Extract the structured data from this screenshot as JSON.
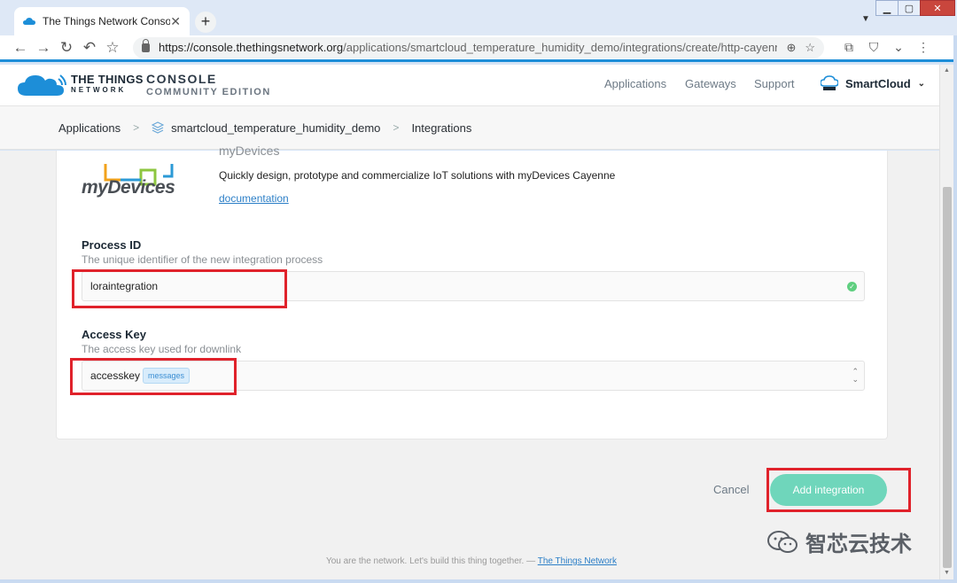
{
  "browser": {
    "tab_title": "The Things Network Console",
    "tab_close": "✕",
    "new_tab": "+",
    "tab_dropdown": "▼",
    "window_minimize": "▁",
    "window_maximize": "▢",
    "window_close": "✕",
    "url_host": "https://console.thethingsnetwork.org",
    "url_path": "/applications/smartcloud_temperature_humidity_demo/integrations/create/http-cayenne",
    "back": "←",
    "forward": "→",
    "reload": "↻",
    "undo": "↶",
    "bookmark": "☆",
    "zoom_icon": "⊕",
    "star_icon": "☆",
    "crop_icon": "⧉",
    "shield_icon": "⛉",
    "menu_icon": "⋮"
  },
  "header": {
    "brand_line1": "THE THINGS",
    "brand_line2": "NETWORK",
    "console_line1": "CONSOLE",
    "console_line2": "COMMUNITY EDITION",
    "nav": [
      "Applications",
      "Gateways",
      "Support"
    ],
    "user": "SmartCloud",
    "user_chevron": "⌄",
    "brand_color": "#1d8ed8"
  },
  "breadcrumb": {
    "items": [
      "Applications",
      "smartcloud_temperature_humidity_demo",
      "Integrations"
    ],
    "separator": ">"
  },
  "integration": {
    "name": "myDevices",
    "logo_text": "myDevices",
    "description": "Quickly design, prototype and commercialize IoT solutions with myDevices Cayenne",
    "documentation_link": "documentation"
  },
  "form": {
    "process_id": {
      "label": "Process ID",
      "hint": "The unique identifier of the new integration process",
      "value": "loraintegration",
      "valid_icon": "✓"
    },
    "access_key": {
      "label": "Access Key",
      "hint": "The access key used for downlink",
      "value": "accesskey",
      "tag": "messages",
      "updown": "⌃⌄"
    },
    "cancel_label": "Cancel",
    "submit_label": "Add integration",
    "submit_color": "#6fd6bb"
  },
  "footer": {
    "text": "You are the network. Let's build this thing together. —",
    "link": "The Things Network"
  },
  "watermark": "智芯云技术",
  "scrollbar": {
    "up": "▲",
    "down": "▼"
  }
}
